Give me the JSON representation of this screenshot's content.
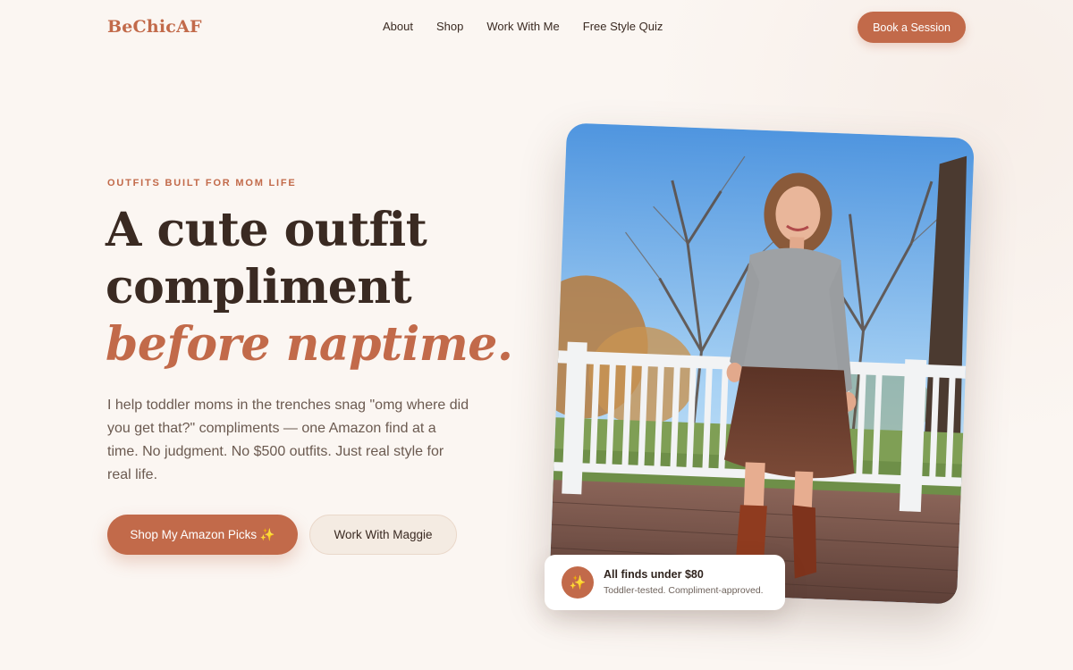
{
  "brand": {
    "name": "BeChicAF"
  },
  "nav": {
    "links": [
      "About",
      "Shop",
      "Work With Me",
      "Free Style Quiz"
    ],
    "cta_label": "Book a Session"
  },
  "hero": {
    "eyebrow": "OUTFITS BUILT FOR MOM LIFE",
    "headline_line1": "A cute outfit",
    "headline_line2": "compliment",
    "headline_accent": "before naptime.",
    "lede": "I help toddler moms in the trenches snag \"omg where did you get that?\" compliments — one Amazon find at a time. No judgment. No $500 outfits. Just real style for real life.",
    "primary_button": "Shop My Amazon Picks ✨",
    "secondary_button": "Work With Maggie"
  },
  "photo_badge": {
    "icon": "sparkle-icon",
    "title": "All finds under $80",
    "subtitle": "Toddler-tested. Compliment-approved."
  },
  "colors": {
    "accent": "#c26a4a",
    "background": "#fbf6f2",
    "text": "#3a2a22"
  }
}
